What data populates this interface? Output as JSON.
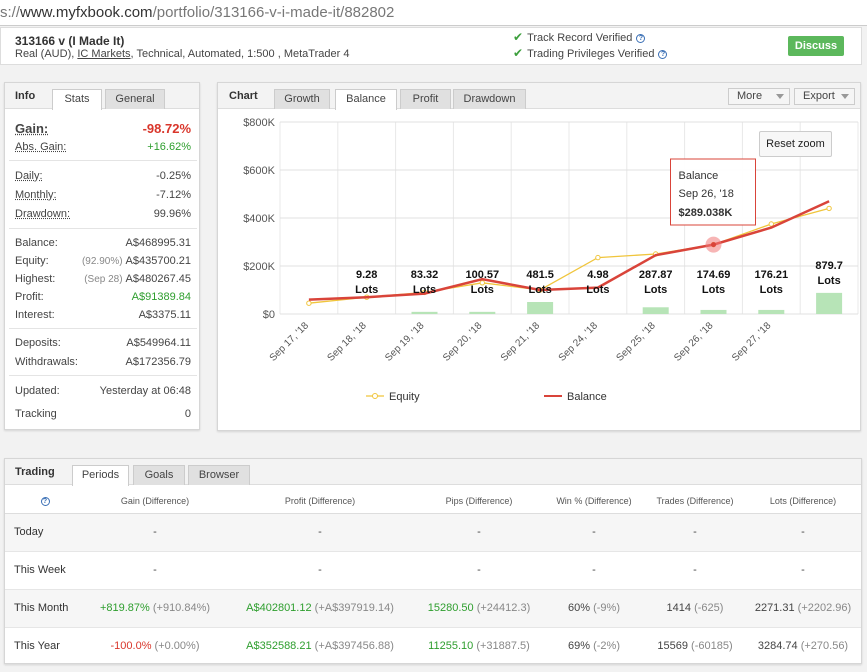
{
  "browser": {
    "url_prefix": "s://",
    "url_main": "www.myfxbook.com",
    "url_path": "/portfolio/313166-v-i-made-it/882802"
  },
  "account": {
    "title": "313166 v (I Made It)",
    "sub_pre": "Real (AUD), ",
    "broker": "IC Markets",
    "sub_post": ", Technical, Automated, 1:500 , MetaTrader 4",
    "verif1": "Track Record Verified",
    "verif2": "Trading Privileges Verified",
    "discuss": "Discuss"
  },
  "info": {
    "title": "Info",
    "tabs": [
      "Stats",
      "General"
    ],
    "gain_label": "Gain:",
    "gain": "-98.72%",
    "abs_gain_label": "Abs. Gain:",
    "abs_gain": "+16.62%",
    "daily_label": "Daily:",
    "daily": "-0.25%",
    "monthly_label": "Monthly:",
    "monthly": "-7.12%",
    "drawdown_label": "Drawdown:",
    "drawdown": "99.96%",
    "balance_label": "Balance:",
    "balance": "A$468995.31",
    "equity_label": "Equity:",
    "equity_pct": "(92.90%)",
    "equity": "A$435700.21",
    "highest_label": "Highest:",
    "highest_date": "(Sep 28)",
    "highest": "A$480267.45",
    "profit_label": "Profit:",
    "profit": "A$91389.84",
    "interest_label": "Interest:",
    "interest": "A$3375.11",
    "deposits_label": "Deposits:",
    "deposits": "A$549964.11",
    "withdrawals_label": "Withdrawals:",
    "withdrawals": "A$172356.79",
    "updated_label": "Updated:",
    "updated": "Yesterday at 06:48",
    "tracking_label": "Tracking",
    "tracking": "0"
  },
  "chart": {
    "title": "Chart",
    "tabs": [
      "Growth",
      "Balance",
      "Profit",
      "Drawdown"
    ],
    "more": "More",
    "export": "Export",
    "reset_zoom": "Reset zoom",
    "legend_equity": "Equity",
    "legend_balance": "Balance",
    "tooltip_name": "Balance",
    "tooltip_date": "Sep 26, '18",
    "tooltip_value": "$289.038K",
    "lots_suffix": "Lots"
  },
  "chart_data": {
    "type": "line",
    "categories": [
      "Sep 17, '18",
      "Sep 18, '18",
      "Sep 19, '18",
      "Sep 20, '18",
      "Sep 21, '18",
      "Sep 24, '18",
      "Sep 25, '18",
      "Sep 26, '18",
      "Sep 27, '18",
      ""
    ],
    "y_ticks": [
      "$0",
      "$200K",
      "$400K",
      "$600K",
      "$800K"
    ],
    "ylim": [
      0,
      800000
    ],
    "grid": true,
    "legend": "bottom",
    "series": [
      {
        "name": "Equity",
        "color": "#f0c53c",
        "points": [
          [
            0.5,
            45000
          ],
          [
            1.5,
            70000
          ],
          [
            2.5,
            90000
          ],
          [
            3.5,
            130000
          ],
          [
            4.5,
            100000
          ],
          [
            5.5,
            235000
          ],
          [
            6.5,
            250000
          ],
          [
            7.5,
            289038
          ],
          [
            8.5,
            375000
          ],
          [
            9.5,
            440000
          ]
        ]
      },
      {
        "name": "Balance",
        "color": "#d9443a",
        "points": [
          [
            0.5,
            60000
          ],
          [
            1.5,
            70000
          ],
          [
            2.5,
            85000
          ],
          [
            3.5,
            145000
          ],
          [
            4.5,
            100000
          ],
          [
            5.5,
            110000
          ],
          [
            6.5,
            245000
          ],
          [
            7.5,
            289038
          ],
          [
            8.5,
            360000
          ],
          [
            9.5,
            470000
          ]
        ]
      }
    ],
    "lots": [
      {
        "x": 1.5,
        "label": "9.28",
        "height": 9.28
      },
      {
        "x": 2.5,
        "label": "83.32",
        "height": 9000
      },
      {
        "x": 3.5,
        "label": "100.57",
        "height": 9000
      },
      {
        "x": 4.5,
        "label": "481.5",
        "height": 50000
      },
      {
        "x": 5.5,
        "label": "4.98",
        "height": 4.98
      },
      {
        "x": 6.5,
        "label": "287.87",
        "height": 28000
      },
      {
        "x": 7.5,
        "label": "174.69",
        "height": 17000
      },
      {
        "x": 8.5,
        "label": "176.21",
        "height": 17000
      },
      {
        "x": 9.5,
        "label": "879.7",
        "height": 88000
      }
    ],
    "highlight": {
      "x": 7.5,
      "y": 289038
    }
  },
  "trading": {
    "title": "Trading",
    "tabs": [
      "Periods",
      "Goals",
      "Browser"
    ],
    "headers": [
      "Gain (Difference)",
      "Profit (Difference)",
      "Pips (Difference)",
      "Win % (Difference)",
      "Trades (Difference)",
      "Lots (Difference)"
    ],
    "rows": [
      {
        "label": "Today",
        "gain": "-",
        "gain_d": "",
        "profit": "-",
        "profit_d": "",
        "pips": "-",
        "pips_d": "",
        "win": "-",
        "win_d": "",
        "trades": "-",
        "trades_d": "",
        "lots": "-",
        "lots_d": ""
      },
      {
        "label": "This Week",
        "gain": "-",
        "gain_d": "",
        "profit": "-",
        "profit_d": "",
        "pips": "-",
        "pips_d": "",
        "win": "-",
        "win_d": "",
        "trades": "-",
        "trades_d": "",
        "lots": "-",
        "lots_d": ""
      },
      {
        "label": "This Month",
        "gain": "+819.87%",
        "gain_d": "(+910.84%)",
        "profit": "A$402801.12",
        "profit_d": "(+A$397919.14)",
        "pips": "15280.50",
        "pips_d": "(+24412.3)",
        "win": "60%",
        "win_d": "(-9%)",
        "trades": "1414",
        "trades_d": "(-625)",
        "lots": "2271.31",
        "lots_d": "(+2202.96)"
      },
      {
        "label": "This Year",
        "gain": "-100.0%",
        "gain_d": "(+0.00%)",
        "profit": "A$352588.21",
        "profit_d": "(+A$397456.88)",
        "pips": "11255.10",
        "pips_d": "(+31887.5)",
        "win": "69%",
        "win_d": "(-2%)",
        "trades": "15569",
        "trades_d": "(-60185)",
        "lots": "3284.74",
        "lots_d": "(+270.56)"
      }
    ]
  }
}
